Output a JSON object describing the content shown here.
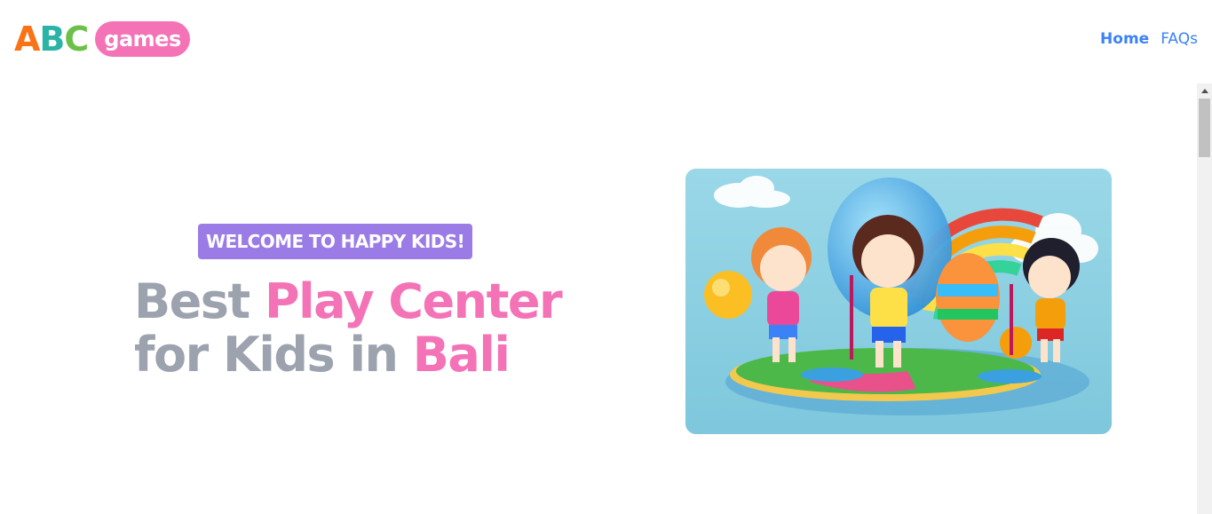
{
  "logo": {
    "letters": [
      {
        "char": "A",
        "color": "#f97316"
      },
      {
        "char": "B",
        "color": "#2bb3a8"
      },
      {
        "char": "C",
        "color": "#6cc04a"
      }
    ],
    "pill_text": "games",
    "pill_color": "#f472b6"
  },
  "nav": {
    "items": [
      {
        "label": "Home",
        "active": true
      },
      {
        "label": "FAQs",
        "active": false
      }
    ]
  },
  "hero": {
    "badge": "WELCOME TO HAPPY KIDS!",
    "headline": {
      "line1_plain": "Best ",
      "line1_accent": "Play Center",
      "line2_plain": "for Kids in ",
      "line2_accent": "Bali"
    },
    "image_icon": "kids-playground-illustration"
  },
  "colors": {
    "accent_pink": "#f472b6",
    "badge_purple": "#9b7be6",
    "headline_gray": "#9ca3af",
    "nav_blue": "#3b82f6"
  }
}
